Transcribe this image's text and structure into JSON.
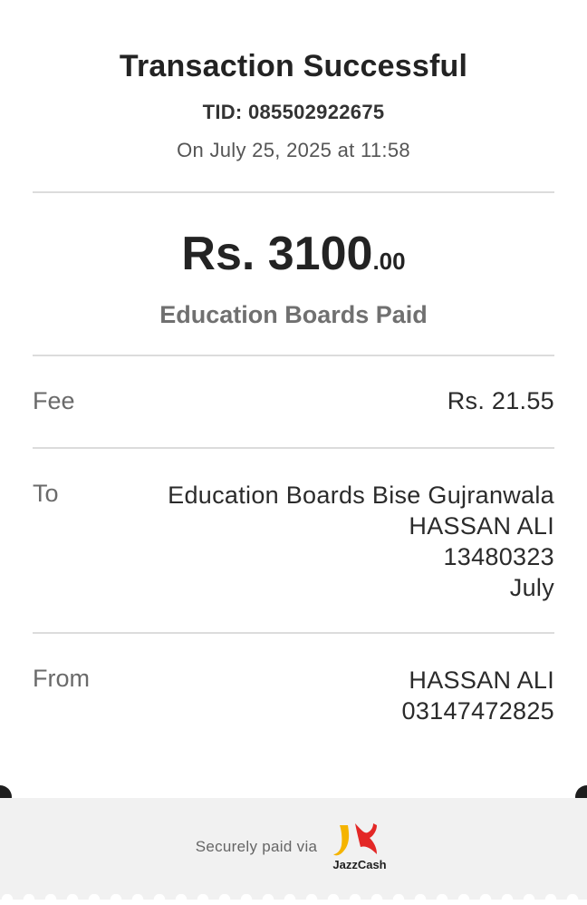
{
  "header": {
    "title": "Transaction Successful",
    "tid": "TID: 085502922675",
    "date": "On July 25, 2025 at 11:58"
  },
  "amount": {
    "main": "Rs. 3100",
    "decimals": ".00",
    "purpose": "Education Boards Paid"
  },
  "fee": {
    "label": "Fee",
    "value": "Rs. 21.55"
  },
  "to": {
    "label": "To",
    "lines": [
      "Education Boards Bise Gujranwala",
      "HASSAN ALI",
      "13480323",
      "July"
    ]
  },
  "from": {
    "label": "From",
    "lines": [
      "HASSAN ALI",
      "03147472825"
    ]
  },
  "footer": {
    "secure_text": "Securely paid via",
    "logo_text": "JazzCash",
    "logo_icon": "jazzcash-logo",
    "colors": {
      "yellow": "#f5b400",
      "red": "#e32726",
      "dark": "#1e1e1e"
    }
  }
}
